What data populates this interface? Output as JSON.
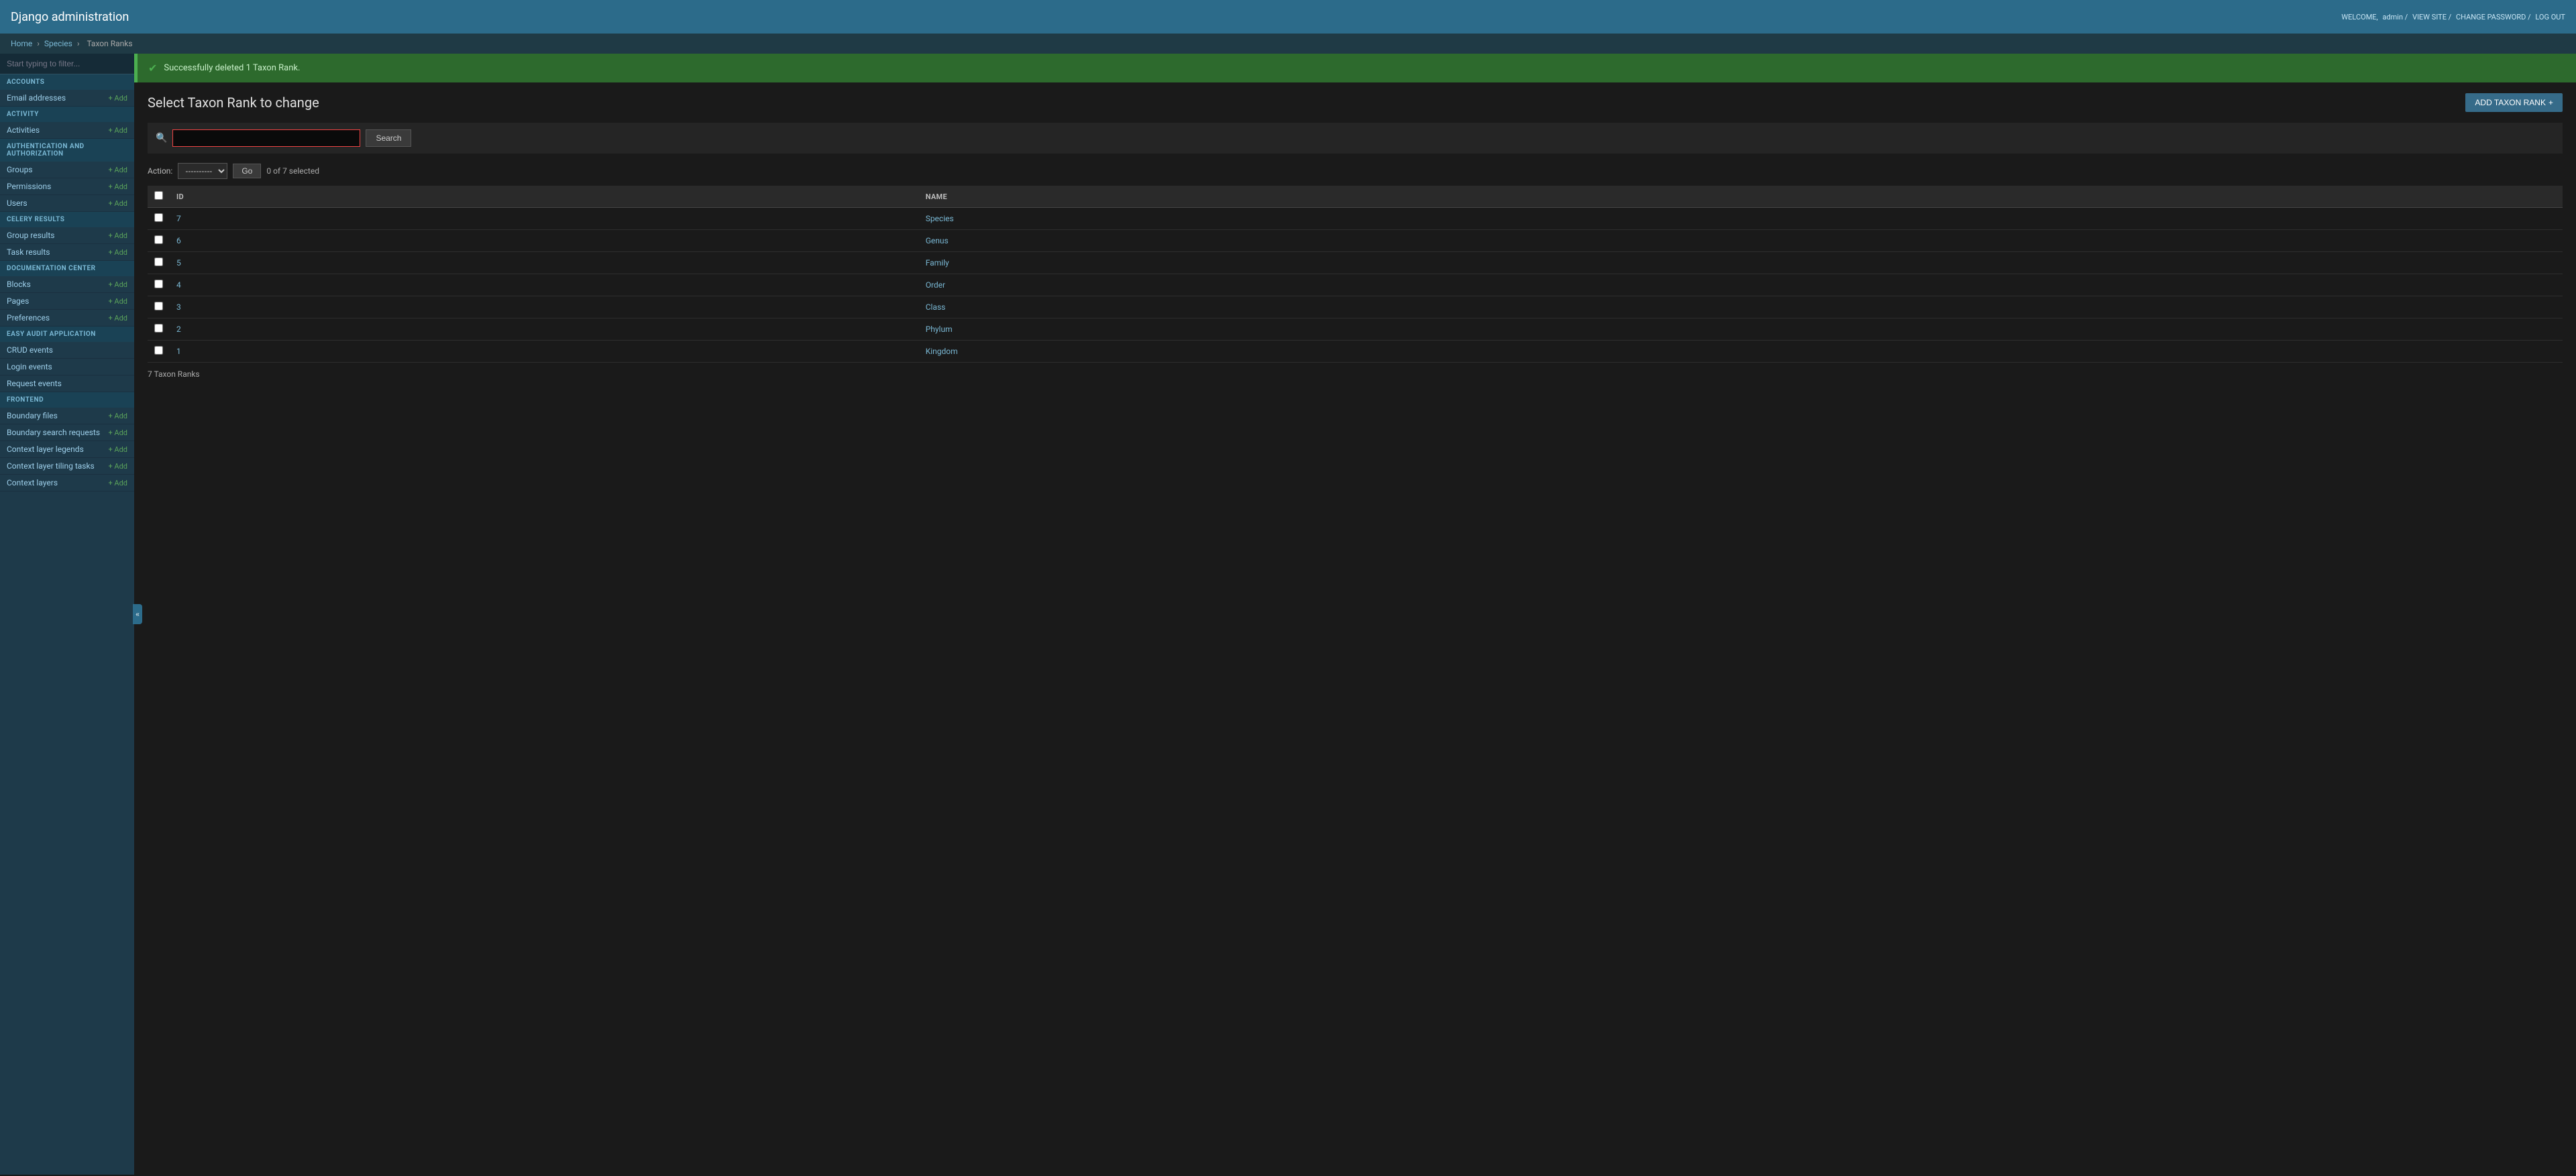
{
  "header": {
    "title": "Django administration",
    "welcome_text": "WELCOME,",
    "username": "admin",
    "links": {
      "view_site": "VIEW SITE",
      "change_password": "CHANGE PASSWORD",
      "log_out": "LOG OUT"
    }
  },
  "breadcrumb": {
    "items": [
      "Home",
      "Species",
      "Taxon Ranks"
    ]
  },
  "sidebar": {
    "filter_placeholder": "Start typing to filter...",
    "sections": [
      {
        "id": "accounts",
        "label": "ACCOUNTS",
        "items": [
          {
            "label": "Email addresses",
            "add": true
          }
        ]
      },
      {
        "id": "activity",
        "label": "ACTIVITY",
        "items": [
          {
            "label": "Activities",
            "add": true
          }
        ]
      },
      {
        "id": "auth",
        "label": "AUTHENTICATION AND AUTHORIZATION",
        "items": [
          {
            "label": "Groups",
            "add": true
          },
          {
            "label": "Permissions",
            "add": true
          },
          {
            "label": "Users",
            "add": true
          }
        ]
      },
      {
        "id": "celery",
        "label": "CELERY RESULTS",
        "items": [
          {
            "label": "Group results",
            "add": true
          },
          {
            "label": "Task results",
            "add": true
          }
        ]
      },
      {
        "id": "documentation",
        "label": "DOCUMENTATION CENTER",
        "items": [
          {
            "label": "Blocks",
            "add": true
          },
          {
            "label": "Pages",
            "add": true
          },
          {
            "label": "Preferences",
            "add": true
          }
        ]
      },
      {
        "id": "easy_audit",
        "label": "EASY AUDIT APPLICATION",
        "items": [
          {
            "label": "CRUD events",
            "add": false
          },
          {
            "label": "Login events",
            "add": false
          },
          {
            "label": "Request events",
            "add": false
          }
        ]
      },
      {
        "id": "frontend",
        "label": "FRONTEND",
        "items": [
          {
            "label": "Boundary files",
            "add": true
          },
          {
            "label": "Boundary search requests",
            "add": true
          },
          {
            "label": "Context layer legends",
            "add": true
          },
          {
            "label": "Context layer tiling tasks",
            "add": true
          },
          {
            "label": "Context layers",
            "add": true
          }
        ]
      }
    ]
  },
  "success_message": "Successfully deleted 1 Taxon Rank.",
  "page_title": "Select Taxon Rank to change",
  "add_button_label": "ADD TAXON RANK",
  "search": {
    "placeholder": "",
    "button_label": "Search"
  },
  "action": {
    "label": "Action:",
    "default_option": "----------",
    "go_label": "Go",
    "selected_text": "0 of 7 selected"
  },
  "table": {
    "columns": [
      "ID",
      "NAME"
    ],
    "rows": [
      {
        "id": "7",
        "name": "Species"
      },
      {
        "id": "6",
        "name": "Genus"
      },
      {
        "id": "5",
        "name": "Family"
      },
      {
        "id": "4",
        "name": "Order"
      },
      {
        "id": "3",
        "name": "Class"
      },
      {
        "id": "2",
        "name": "Phylum"
      },
      {
        "id": "1",
        "name": "Kingdom"
      }
    ],
    "footer_text": "7 Taxon Ranks"
  }
}
